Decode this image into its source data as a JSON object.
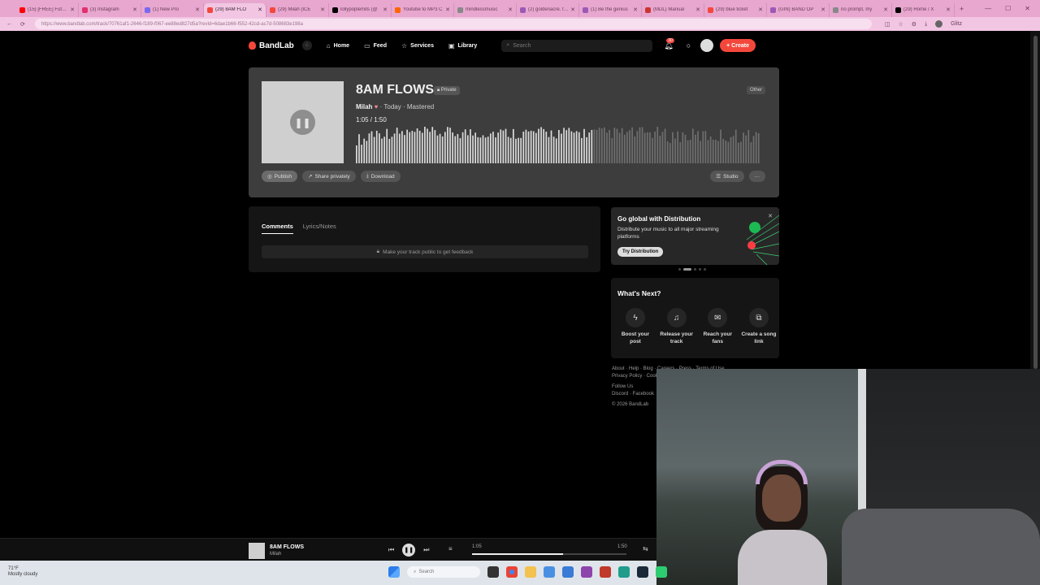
{
  "browser": {
    "tabs": [
      {
        "label": "(15) [FREE] Future",
        "color": "#ff0000"
      },
      {
        "label": "(3) Instagram",
        "color": "#e1306c"
      },
      {
        "label": "(1) New Pro",
        "color": "#7b68ee"
      },
      {
        "label": "(29) 8AM FLO",
        "color": "#f4473b",
        "active": true
      },
      {
        "label": "(29) Milah (ICE",
        "color": "#f4473b"
      },
      {
        "label": "lollypoplemits (@",
        "color": "#000000"
      },
      {
        "label": "Youtube to MP3 C",
        "color": "#ff6600"
      },
      {
        "label": "mindlessmusic",
        "color": "#888888"
      },
      {
        "label": "(2) goldenacre. fun",
        "color": "#9b59b6"
      },
      {
        "label": "(1) Be the genius",
        "color": "#9b59b6"
      },
      {
        "label": "(MDL) Manual",
        "color": "#cc3333"
      },
      {
        "label": "(29) blue ticket",
        "color": "#f4473b"
      },
      {
        "label": "(GIN) BAND OP",
        "color": "#9b59b6"
      },
      {
        "label": "no prompt, my",
        "color": "#888888"
      },
      {
        "label": "(29) Home / X",
        "color": "#000000"
      }
    ],
    "new_tab": "+",
    "url": "https://www.bandlab.com/track/70761af1-2646-f189-f067-ee88ed827d5a?revId=6dae1b66-f552-42cd-ac7d-508683e198a",
    "profile": "Glitz"
  },
  "nav": {
    "brand": "BandLab",
    "items": [
      {
        "label": "Home",
        "icon": "home-icon"
      },
      {
        "label": "Feed",
        "icon": "feed-icon"
      },
      {
        "label": "Services",
        "icon": "star-icon"
      },
      {
        "label": "Library",
        "icon": "library-icon"
      }
    ],
    "search_placeholder": "Search",
    "notif_count": "30",
    "create": "+ Create"
  },
  "track": {
    "title": "8AM FLOWS",
    "privacy": "Private",
    "genre": "Other",
    "artist": "Milah",
    "date": "Today",
    "status": "Mastered",
    "current_time": "1:05",
    "duration": "1:50",
    "progress": 0.59,
    "buttons": {
      "publish": "Publish",
      "share": "Share privately",
      "download": "Download",
      "studio": "Studio",
      "more": "···"
    }
  },
  "comments": {
    "tabs": [
      "Comments",
      "Lyrics/Notes"
    ],
    "message": "Make your track public to get feedback"
  },
  "promo": {
    "title": "Go global with Distribution",
    "text": "Distribute your music to all major streaming platforms",
    "cta": "Try Distribution"
  },
  "whats_next": {
    "title": "What's Next?",
    "actions": [
      {
        "label": "Boost your post",
        "icon": "bolt-icon"
      },
      {
        "label": "Release your track",
        "icon": "release-icon"
      },
      {
        "label": "Reach your fans",
        "icon": "mail-icon"
      },
      {
        "label": "Create a song link",
        "icon": "link-icon"
      }
    ]
  },
  "footer": {
    "line1": "About · Help · Blog · Careers · Press · Terms of Use",
    "line2": "Privacy Policy · Cookie",
    "follow": "Follow Us",
    "social": "Discord · Facebook",
    "copyright": "© 2026 BandLab"
  },
  "player": {
    "title": "8AM FLOWS",
    "artist": "Milah",
    "current_time": "1:05",
    "duration": "1:50",
    "progress": 0.59
  },
  "taskbar": {
    "weather_temp": "71°F",
    "weather_text": "Mostly cloudy",
    "search": "Search"
  }
}
